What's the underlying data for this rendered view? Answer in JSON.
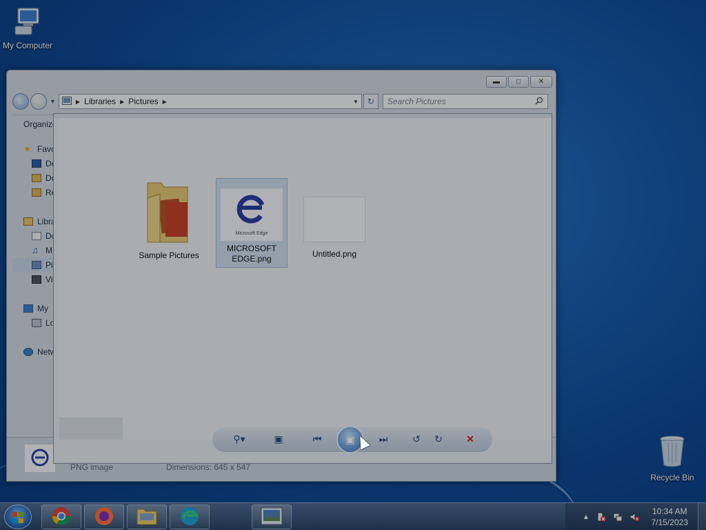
{
  "desktop": {
    "my_computer_label": "My Computer",
    "recycle_bin_label": "Recycle Bin"
  },
  "explorer": {
    "breadcrumb": [
      "Libraries",
      "Pictures"
    ],
    "search_placeholder": "Search Pictures",
    "toolbar_organize": "Organize",
    "nav": {
      "favorites": "Favo",
      "desktop": "De",
      "downloads": "Do",
      "recent": "Re",
      "libraries": "Libra",
      "documents": "Do",
      "music": "M",
      "pictures": "Pi",
      "videos": "Vi",
      "my_computer": "My",
      "local_disk": "Lo",
      "network": "Netw"
    },
    "details": {
      "type": "PNG image",
      "dimensions": "Dimensions: 645 x 547"
    }
  },
  "files": [
    {
      "name": "Sample Pictures",
      "kind": "folder"
    },
    {
      "name": "MICROSOFT EDGE.png",
      "kind": "image",
      "thumb_caption": "Microsoft Edge"
    },
    {
      "name": "Untitled.png",
      "kind": "image"
    }
  ],
  "taskbar": {
    "time": "10:34 AM",
    "date": "7/15/2023"
  }
}
